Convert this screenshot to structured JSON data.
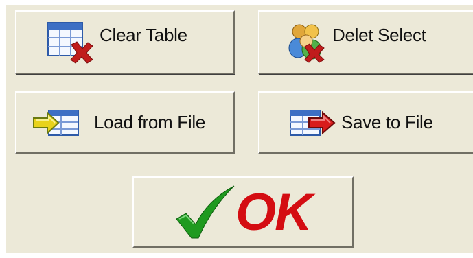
{
  "buttons": {
    "clear_table": {
      "label": "Clear Table",
      "icon": "table-delete-icon"
    },
    "delete_select": {
      "label": "Delet Select",
      "icon": "users-delete-icon"
    },
    "load_from_file": {
      "label": "Load from File",
      "icon": "file-import-icon"
    },
    "save_to_file": {
      "label": "Save to File",
      "icon": "file-export-icon"
    },
    "ok": {
      "label": "OK",
      "icon": "checkmark-icon"
    }
  },
  "colors": {
    "face": "#ece9d8",
    "ok_text": "#d40d12",
    "check": "#1f9a1f",
    "delete_x": "#c01c1c"
  }
}
